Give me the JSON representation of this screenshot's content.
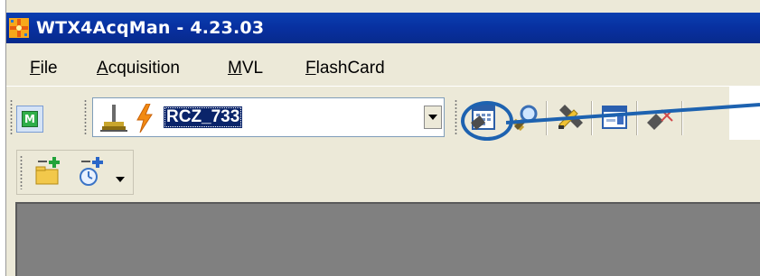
{
  "window": {
    "title": "WTX4AcqMan - 4.23.03"
  },
  "menu": {
    "items": [
      {
        "label": "File",
        "accel": "F",
        "rest": "ile"
      },
      {
        "label": "Acquisition",
        "accel": "A",
        "rest": "cquisition"
      },
      {
        "label": "MVL",
        "accel": "M",
        "rest": "VL"
      },
      {
        "label": "FlashCard",
        "accel": "F",
        "rest": "lashCard"
      }
    ]
  },
  "toolbar": {
    "mode_button_label": "M",
    "device_select": {
      "value": "RCZ_733"
    },
    "icons": [
      "connection-icon",
      "lightning-icon",
      "device-config-icon",
      "search-device-icon",
      "tools-icon",
      "report-icon",
      "disconnect-icon"
    ]
  },
  "toolbar2": {
    "icons": [
      "new-folder-icon",
      "new-timer-icon"
    ]
  },
  "colors": {
    "titlebar": "#0a3fb0",
    "highlight": "#1d62b0",
    "selection": "#0a246a",
    "client": "#808080"
  }
}
